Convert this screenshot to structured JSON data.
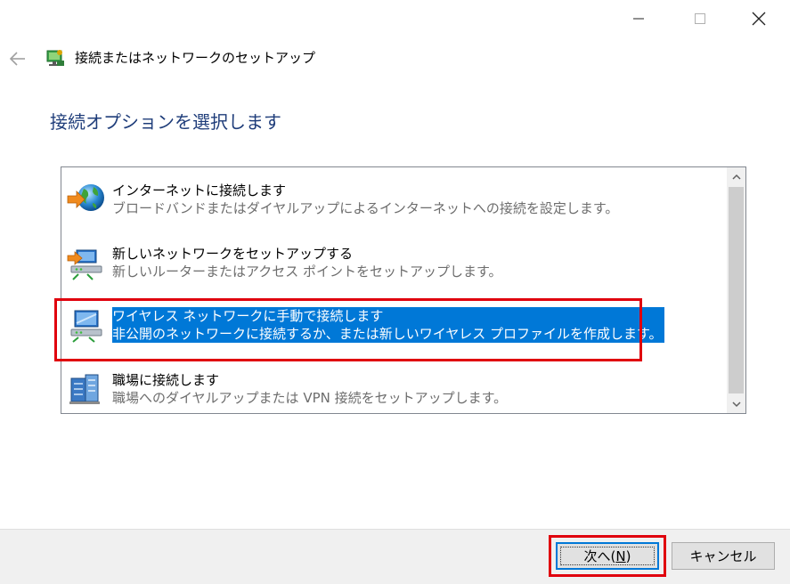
{
  "window": {
    "title": "接続またはネットワークのセットアップ"
  },
  "page": {
    "heading": "接続オプションを選択します"
  },
  "options": [
    {
      "title": "インターネットに接続します",
      "description": "ブロードバンドまたはダイヤルアップによるインターネットへの接続を設定します。",
      "icon": "globe-icon"
    },
    {
      "title": "新しいネットワークをセットアップする",
      "description": "新しいルーターまたはアクセス ポイントをセットアップします。",
      "icon": "router-icon"
    },
    {
      "title": "ワイヤレス ネットワークに手動で接続します",
      "description": "非公開のネットワークに接続するか、または新しいワイヤレス プロファイルを作成します。",
      "icon": "wireless-network-icon",
      "selected": true
    },
    {
      "title": "職場に接続します",
      "description": "職場へのダイヤルアップまたは VPN 接続をセットアップします。",
      "icon": "workplace-icon"
    }
  ],
  "buttons": {
    "next_label": "次へ(",
    "next_mnemonic": "N",
    "next_suffix": ")",
    "cancel_label": "キャンセル"
  },
  "colors": {
    "heading": "#1f3d7a",
    "selection": "#0078d7",
    "highlight_annotation": "#e0000d"
  }
}
